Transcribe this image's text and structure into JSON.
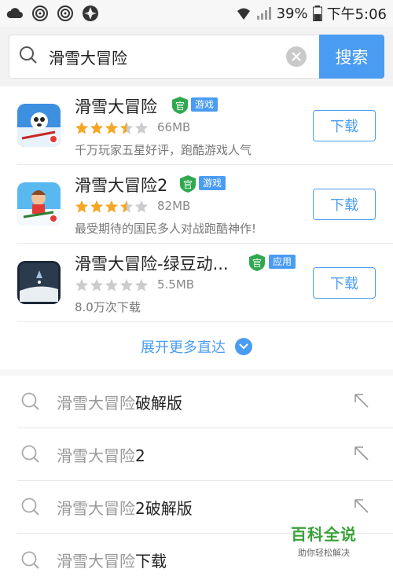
{
  "status_bar": {
    "battery": "39%",
    "time": "下午5:06"
  },
  "search": {
    "query": "滑雪大冒险",
    "button_label": "搜索"
  },
  "apps": [
    {
      "name": "滑雪大冒险",
      "official_badge": "官",
      "category": "游戏",
      "rating": 3.5,
      "size": "66MB",
      "description": "千万玩家五星好评，跑酷游戏人气",
      "download_label": "下载"
    },
    {
      "name": "滑雪大冒险2",
      "official_badge": "官",
      "category": "游戏",
      "rating": 3.5,
      "size": "82MB",
      "description": "最受期待的国民多人对战跑酷神作!",
      "download_label": "下载"
    },
    {
      "name": "滑雪大冒险-绿豆动...",
      "official_badge": "官",
      "category": "应用",
      "rating": 0,
      "size": "5.5MB",
      "description": "8.0万次下载",
      "download_label": "下载"
    }
  ],
  "expand": {
    "label": "展开更多直达"
  },
  "suggestions": [
    {
      "prefix": "滑雪大冒险",
      "suffix": "破解版"
    },
    {
      "prefix": "滑雪大冒险",
      "suffix": "2"
    },
    {
      "prefix": "滑雪大冒险",
      "suffix": "2破解版"
    },
    {
      "prefix": "滑雪大冒险",
      "suffix": "下载"
    }
  ],
  "watermark": {
    "title": "百科全说",
    "subtitle": "助你轻松解决"
  },
  "colors": {
    "accent": "#4a9cf2",
    "star_on": "#f5a623",
    "star_off": "#cccccc",
    "official_green": "#2fa84f"
  }
}
